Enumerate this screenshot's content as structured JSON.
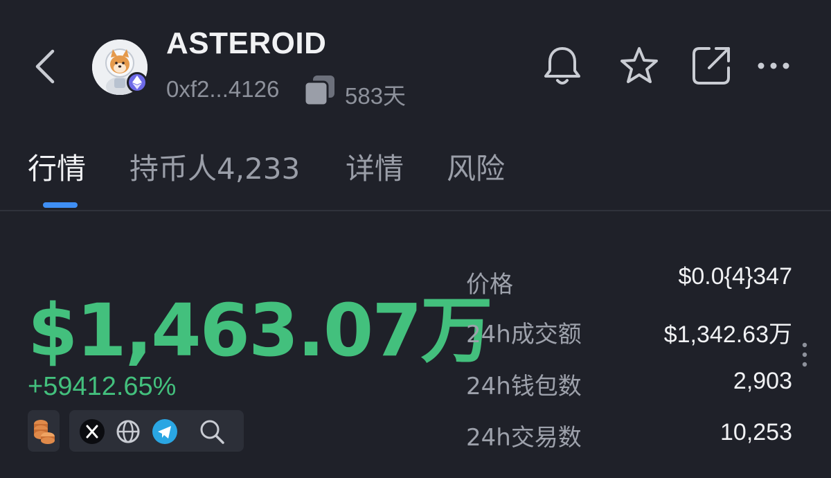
{
  "header": {
    "token_name": "ASTEROID",
    "contract_address": "0xf2...4126",
    "age": "583天",
    "icons": [
      "back-arrow-icon",
      "ethereum-chain-icon",
      "copy-icon",
      "bell-icon",
      "star-icon",
      "share-icon",
      "more-icon"
    ]
  },
  "tabs": [
    {
      "label": "行情",
      "active": true
    },
    {
      "label": "持币人4,233",
      "active": false
    },
    {
      "label": "详情",
      "active": false
    },
    {
      "label": "风险",
      "active": false
    }
  ],
  "summary": {
    "market_cap": "$1,463.07万",
    "change": "+59412.65%",
    "socials": [
      "coins-icon",
      "x-icon",
      "globe-icon",
      "telegram-icon",
      "search-icon"
    ]
  },
  "stats": [
    {
      "label": "价格",
      "value": "$0.0{4}347"
    },
    {
      "label": "24h成交额",
      "value": "$1,342.63万"
    },
    {
      "label": "24h钱包数",
      "value": "2,903"
    },
    {
      "label": "24h交易数",
      "value": "10,253"
    }
  ],
  "colors": {
    "background": "#1f2129",
    "positive": "#43c07d",
    "accent": "#3f8ff5",
    "muted_text": "#9da1ab"
  }
}
